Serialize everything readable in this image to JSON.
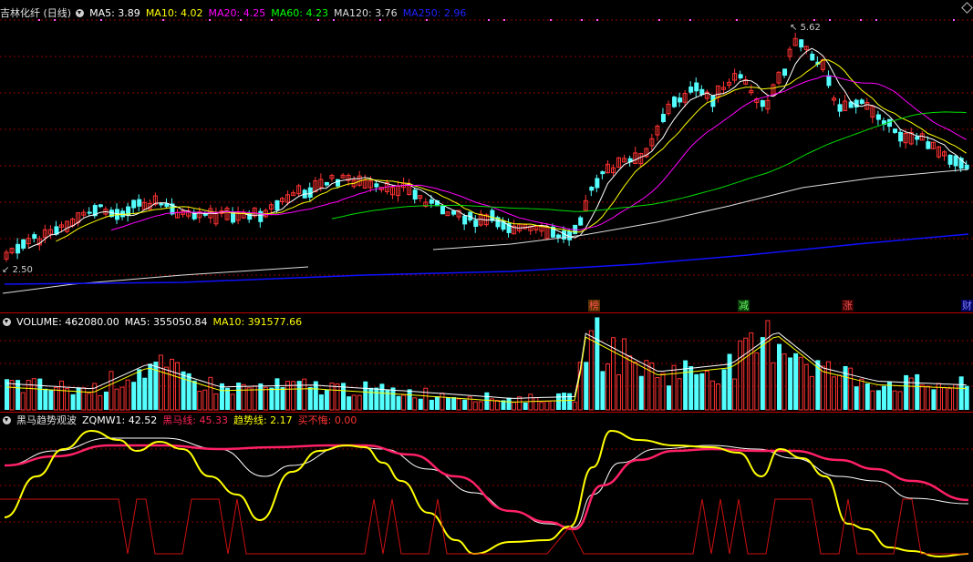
{
  "main_panel": {
    "stock_title": "吉林化纤 (日线)",
    "indicators": [
      {
        "label": "MA5: 3.89",
        "color": "#ffffff"
      },
      {
        "label": "MA10: 4.02",
        "color": "#ffff00"
      },
      {
        "label": "MA20: 4.25",
        "color": "#ff00ff"
      },
      {
        "label": "MA60: 4.23",
        "color": "#00ff00"
      },
      {
        "label": "MA120: 3.76",
        "color": "#dddddd"
      },
      {
        "label": "MA250: 2.96",
        "color": "#0000ff"
      }
    ],
    "high_annotation": "5.62",
    "low_annotation": "2.50",
    "event_markers": [
      {
        "text": "榜",
        "color": "#ff3333",
        "bg": "#5a3200"
      },
      {
        "text": "减",
        "color": "#66ff66",
        "bg": "#0a3a0a"
      },
      {
        "text": "涨",
        "color": "#ff5555",
        "bg": "#3a0000"
      },
      {
        "text": "财",
        "color": "#8080ff",
        "bg": "#000060"
      }
    ]
  },
  "volume_panel": {
    "indicators": [
      {
        "label": "VOLUME: 462080.00",
        "color": "#ffffff"
      },
      {
        "label": "MA5: 355050.84",
        "color": "#ffffff"
      },
      {
        "label": "MA10: 391577.66",
        "color": "#ffff00"
      }
    ]
  },
  "indicator_panel": {
    "name": "黑马趋势观波",
    "indicators": [
      {
        "label": "ZQMW1: 42.52",
        "color": "#ffffff"
      },
      {
        "label": "黑马线: 45.33",
        "color": "#ff2255"
      },
      {
        "label": "趋势线: 2.17",
        "color": "#ffff00"
      },
      {
        "label": "买不悔: 0.00",
        "color": "#ff3333"
      }
    ]
  },
  "colors": {
    "up": "#ff3232",
    "down": "#54ffff",
    "grid": "#8b0000",
    "border": "#c00000"
  }
}
